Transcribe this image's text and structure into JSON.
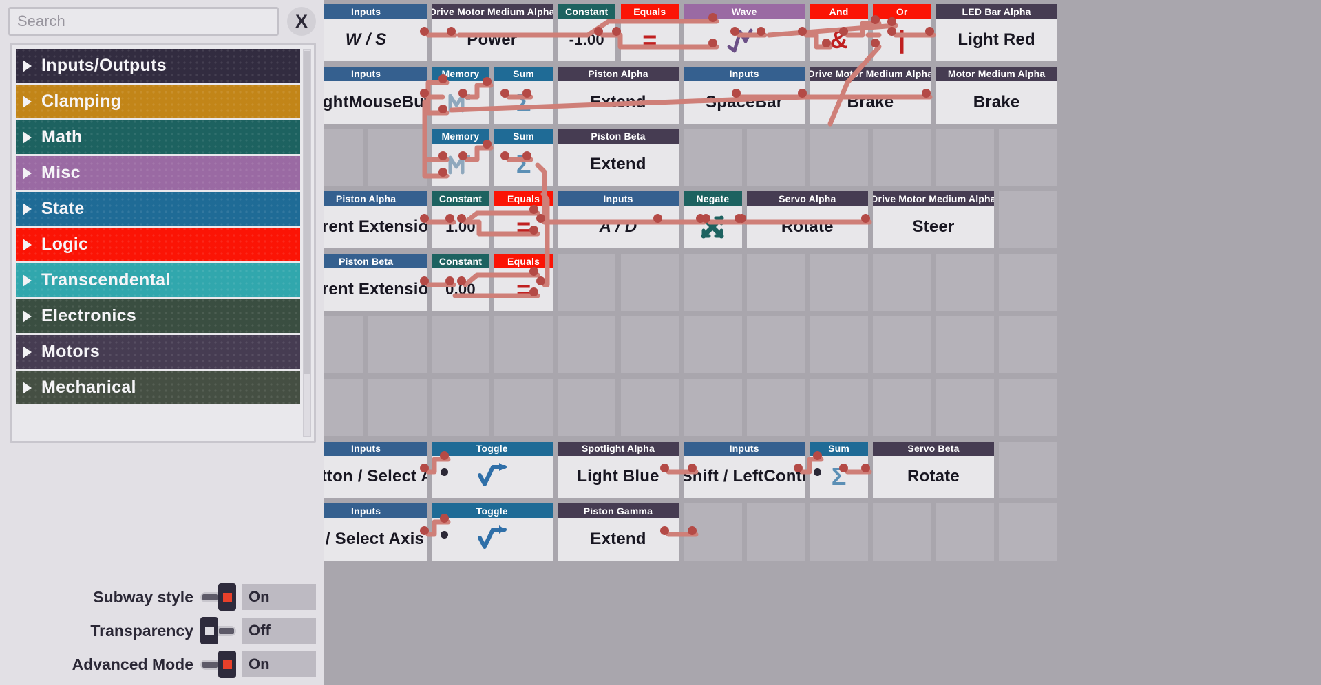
{
  "search": {
    "placeholder": "Search",
    "value": "",
    "clear_label": "X"
  },
  "sidebar": {
    "categories": [
      {
        "label": "Inputs/Outputs",
        "color": "#322c40"
      },
      {
        "label": "Clamping",
        "color": "#c28518"
      },
      {
        "label": "Math",
        "color": "#1d6260"
      },
      {
        "label": "Misc",
        "color": "#9a6aa3"
      },
      {
        "label": "State",
        "color": "#1f6b96"
      },
      {
        "label": "Logic",
        "color": "#fb1405"
      },
      {
        "label": "Transcendental",
        "color": "#31a7ad"
      },
      {
        "label": "Electronics",
        "color": "#3a4e41"
      },
      {
        "label": "Motors",
        "color": "#463c52"
      },
      {
        "label": "Mechanical",
        "color": "#454f43"
      }
    ]
  },
  "settings": [
    {
      "label": "Subway style",
      "state": "on",
      "value": "On"
    },
    {
      "label": "Transparency",
      "state": "off",
      "value": "Off"
    },
    {
      "label": "Advanced Mode",
      "state": "on",
      "value": "On"
    }
  ],
  "palette": {
    "inputs": "#35608f",
    "state": "#1f6b96",
    "math": "#1d6260",
    "logic": "#fb1405",
    "misc": "#9a6aa3",
    "device": "#463c52",
    "canvas_bg": "#a9a6ad",
    "cell_bg": "#b5b2b9",
    "node_body": "#e8e7ea",
    "wire": "#cf7f78",
    "port": "#b44a46"
  },
  "nodes": [
    {
      "id": "n1",
      "header": "Inputs",
      "header_color": "#35608f",
      "text": "W / S",
      "kind": "text",
      "col": 0,
      "row": 0,
      "span": 2
    },
    {
      "id": "n2",
      "header": "Drive Motor Medium Alpha",
      "header_color": "#463c52",
      "text": "Power",
      "kind": "text",
      "col": 2,
      "row": 0,
      "span": 2
    },
    {
      "id": "n3",
      "header": "Constant",
      "header_color": "#1d6260",
      "text": "-1.00",
      "kind": "text",
      "col": 4,
      "row": 0,
      "span": 1
    },
    {
      "id": "n4",
      "header": "Equals",
      "header_color": "#fb1405",
      "text": "=",
      "kind": "glyph",
      "glyph_color": "#c02020",
      "col": 5,
      "row": 0,
      "span": 1
    },
    {
      "id": "n5",
      "header": "Wave",
      "header_color": "#9a6aa3",
      "text": "wave-glyph",
      "kind": "wave",
      "col": 6,
      "row": 0,
      "span": 2
    },
    {
      "id": "n6",
      "header": "And",
      "header_color": "#fb1405",
      "text": "&",
      "kind": "glyph",
      "glyph_color": "#c02020",
      "col": 8,
      "row": 0,
      "span": 1
    },
    {
      "id": "n7",
      "header": "Or",
      "header_color": "#fb1405",
      "text": "|",
      "kind": "glyph",
      "glyph_color": "#c02020",
      "col": 9,
      "row": 0,
      "span": 1
    },
    {
      "id": "n8",
      "header": "LED Bar Alpha",
      "header_color": "#463c52",
      "text": "Light Red",
      "kind": "text",
      "col": 10,
      "row": 0,
      "span": 2
    },
    {
      "id": "n9",
      "header": "Inputs",
      "header_color": "#35608f",
      "text": "/ RightMouseButt",
      "kind": "text",
      "col": 0,
      "row": 1,
      "span": 2
    },
    {
      "id": "n10",
      "header": "Memory",
      "header_color": "#1f6b96",
      "text": "M",
      "kind": "memory",
      "col": 2,
      "row": 1,
      "span": 1
    },
    {
      "id": "n11",
      "header": "Sum",
      "header_color": "#1f6b96",
      "text": "Σ",
      "kind": "glyph",
      "glyph_color": "#5b8fb5",
      "col": 3,
      "row": 1,
      "span": 1
    },
    {
      "id": "n12",
      "header": "Piston Alpha",
      "header_color": "#463c52",
      "text": "Extend",
      "kind": "text",
      "col": 4,
      "row": 1,
      "span": 2
    },
    {
      "id": "n13",
      "header": "Inputs",
      "header_color": "#35608f",
      "text": "SpaceBar",
      "kind": "text",
      "col": 6,
      "row": 1,
      "span": 2
    },
    {
      "id": "n14",
      "header": "Drive Motor Medium Alpha",
      "header_color": "#463c52",
      "text": "Brake",
      "kind": "text",
      "col": 8,
      "row": 1,
      "span": 2
    },
    {
      "id": "n15",
      "header": "Motor Medium Alpha",
      "header_color": "#463c52",
      "text": "Brake",
      "kind": "text",
      "col": 10,
      "row": 1,
      "span": 2
    },
    {
      "id": "n16",
      "header": "Memory",
      "header_color": "#1f6b96",
      "text": "M",
      "kind": "memory",
      "col": 2,
      "row": 2,
      "span": 1
    },
    {
      "id": "n17",
      "header": "Sum",
      "header_color": "#1f6b96",
      "text": "Σ",
      "kind": "glyph",
      "glyph_color": "#5b8fb5",
      "col": 3,
      "row": 2,
      "span": 1
    },
    {
      "id": "n18",
      "header": "Piston Beta",
      "header_color": "#463c52",
      "text": "Extend",
      "kind": "text",
      "col": 4,
      "row": 2,
      "span": 2
    },
    {
      "id": "n19",
      "header": "Piston Alpha",
      "header_color": "#35608f",
      "text": "Current Extension",
      "kind": "text",
      "col": 0,
      "row": 3,
      "span": 2
    },
    {
      "id": "n20",
      "header": "Constant",
      "header_color": "#1d6260",
      "text": "1.00",
      "kind": "text",
      "col": 2,
      "row": 3,
      "span": 1
    },
    {
      "id": "n21",
      "header": "Equals",
      "header_color": "#fb1405",
      "text": "=",
      "kind": "glyph",
      "glyph_color": "#c02020",
      "col": 3,
      "row": 3,
      "span": 1
    },
    {
      "id": "n22",
      "header": "Inputs",
      "header_color": "#35608f",
      "text": "A / D",
      "kind": "text",
      "col": 4,
      "row": 3,
      "span": 2
    },
    {
      "id": "n23",
      "header": "Negate",
      "header_color": "#1d6260",
      "text": "X",
      "kind": "negate",
      "col": 6,
      "row": 3,
      "span": 1
    },
    {
      "id": "n24",
      "header": "Servo Alpha",
      "header_color": "#463c52",
      "text": "Rotate",
      "kind": "text",
      "col": 7,
      "row": 3,
      "span": 2
    },
    {
      "id": "n25",
      "header": "Drive Motor Medium Alpha",
      "header_color": "#463c52",
      "text": "Steer",
      "kind": "text",
      "col": 9,
      "row": 3,
      "span": 2
    },
    {
      "id": "n26",
      "header": "Piston Beta",
      "header_color": "#35608f",
      "text": "Current Extension",
      "kind": "text",
      "col": 0,
      "row": 4,
      "span": 2
    },
    {
      "id": "n27",
      "header": "Constant",
      "header_color": "#1d6260",
      "text": "0.00",
      "kind": "text",
      "col": 2,
      "row": 4,
      "span": 1
    },
    {
      "id": "n28",
      "header": "Equals",
      "header_color": "#fb1405",
      "text": "=",
      "kind": "glyph",
      "glyph_color": "#c02020",
      "col": 3,
      "row": 4,
      "span": 1
    },
    {
      "id": "n29",
      "header": "Inputs",
      "header_color": "#35608f",
      "text": "eButton / Select Ax",
      "kind": "text",
      "col": 0,
      "row": 7,
      "span": 2
    },
    {
      "id": "n30",
      "header": "Toggle",
      "header_color": "#1f6b96",
      "text": "toggle-glyph",
      "kind": "toggle",
      "col": 2,
      "row": 7,
      "span": 2
    },
    {
      "id": "n31",
      "header": "Spotlight Alpha",
      "header_color": "#463c52",
      "text": "Light Blue",
      "kind": "text",
      "col": 4,
      "row": 7,
      "span": 2
    },
    {
      "id": "n32",
      "header": "Inputs",
      "header_color": "#35608f",
      "text": "ftShift / LeftContro",
      "kind": "text",
      "col": 6,
      "row": 7,
      "span": 2
    },
    {
      "id": "n33",
      "header": "Sum",
      "header_color": "#1f6b96",
      "text": "Σ",
      "kind": "glyph",
      "glyph_color": "#5b8fb5",
      "col": 8,
      "row": 7,
      "span": 1
    },
    {
      "id": "n34",
      "header": "Servo Beta",
      "header_color": "#463c52",
      "text": "Rotate",
      "kind": "text",
      "col": 9,
      "row": 7,
      "span": 2
    },
    {
      "id": "n35",
      "header": "Inputs",
      "header_color": "#35608f",
      "text": "Q / Select Axis",
      "kind": "text",
      "col": 0,
      "row": 8,
      "span": 2
    },
    {
      "id": "n36",
      "header": "Toggle",
      "header_color": "#1f6b96",
      "text": "toggle-glyph",
      "kind": "toggle",
      "col": 2,
      "row": 8,
      "span": 2
    },
    {
      "id": "n37",
      "header": "Piston Gamma",
      "header_color": "#463c52",
      "text": "Extend",
      "kind": "text",
      "col": 4,
      "row": 8,
      "span": 2
    }
  ]
}
